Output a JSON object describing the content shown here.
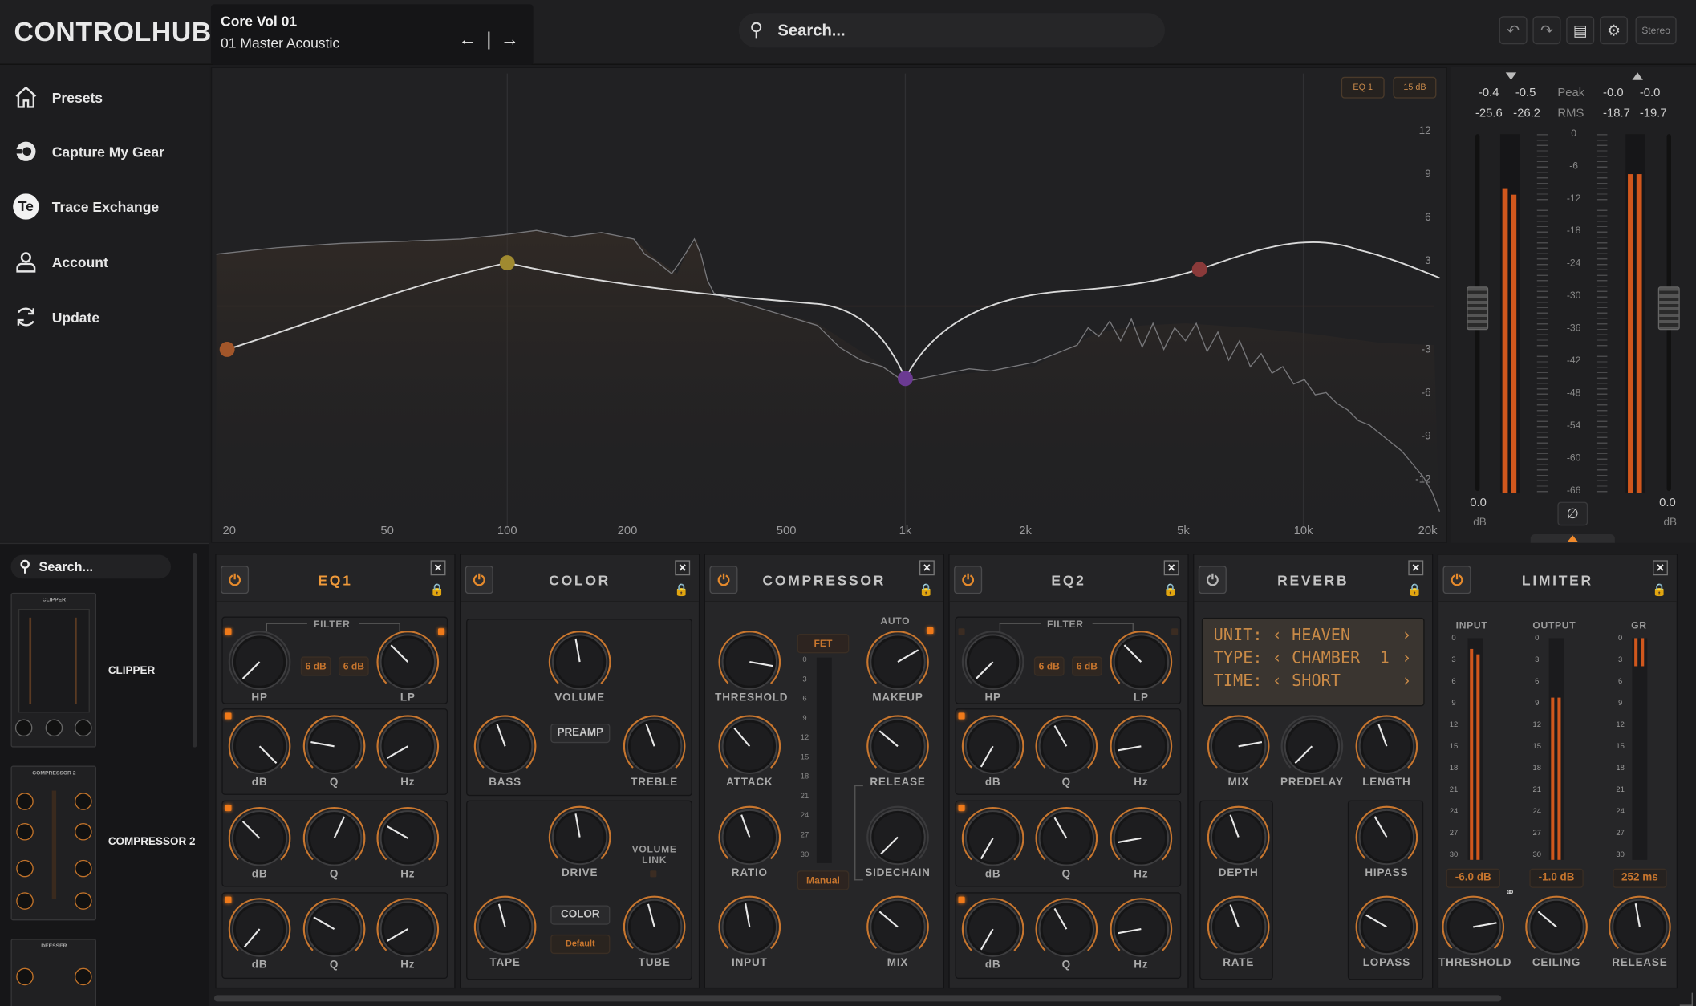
{
  "app": {
    "logo": "CONTROLHUB"
  },
  "preset": {
    "bank": "Core Vol 01",
    "name": "01 Master Acoustic",
    "nav": "← | →"
  },
  "search": {
    "placeholder": "Search..."
  },
  "toolbar": {
    "stereo": "Stereo",
    "icons": [
      "undo-icon",
      "redo-icon",
      "save-icon",
      "gear-icon"
    ]
  },
  "nav": {
    "items": [
      {
        "label": "Presets",
        "icon": "home-icon"
      },
      {
        "label": "Capture My Gear",
        "icon": "capture-icon"
      },
      {
        "label": "Trace Exchange",
        "icon": "te-icon",
        "glyph": "Te"
      },
      {
        "label": "Account",
        "icon": "user-icon"
      },
      {
        "label": "Update",
        "icon": "refresh-icon"
      }
    ]
  },
  "browser": {
    "search": "Search...",
    "items": [
      {
        "label": "CLIPPER",
        "thumb_title": "CLIPPER"
      },
      {
        "label": "COMPRESSOR 2",
        "thumb_title": "COMPRESSOR 2"
      },
      {
        "label": "",
        "thumb_title": "DEESSER"
      }
    ]
  },
  "eq_display": {
    "tags": [
      "EQ 1",
      "15 dB"
    ],
    "db_labels": [
      "12",
      "9",
      "6",
      "3",
      "-3",
      "-6",
      "-9",
      "-12"
    ],
    "freq_labels": [
      "20",
      "50",
      "100",
      "200",
      "500",
      "1k",
      "2k",
      "5k",
      "10k",
      "20k"
    ]
  },
  "meter": {
    "peak_label": "Peak",
    "rms_label": "RMS",
    "in_peak": [
      "-0.4",
      "-0.5"
    ],
    "in_rms": [
      "-25.6",
      "-26.2"
    ],
    "out_peak": [
      "-0.0",
      "-0.0"
    ],
    "out_rms": [
      "-18.7",
      "-19.7"
    ],
    "scale": [
      "0",
      "-6",
      "-12",
      "-18",
      "-24",
      "-30",
      "-36",
      "-42",
      "-48",
      "-54",
      "-60",
      "-66"
    ],
    "in_gain": "0.0",
    "out_gain": "0.0",
    "unit": "dB",
    "phase_icon": "phase-invert-icon",
    "levels": {
      "in_l": 0.85,
      "in_r": 0.83,
      "out_l": 0.89,
      "out_r": 0.89
    }
  },
  "modules": [
    {
      "title": "EQ1",
      "on": true
    },
    {
      "title": "COLOR",
      "on": false
    },
    {
      "title": "COMPRESSOR",
      "on": false
    },
    {
      "title": "EQ2",
      "on": false
    },
    {
      "title": "REVERB",
      "on": false
    },
    {
      "title": "LIMITER",
      "on": false
    }
  ],
  "eq1": {
    "filter": "FILTER",
    "slope_hp": "6 dB",
    "slope_lp": "6 dB",
    "row1": [
      "HP",
      "LP"
    ],
    "bands": [
      "dB",
      "Q",
      "Hz"
    ]
  },
  "color": {
    "volume": "VOLUME",
    "preamp": "PREAMP",
    "bass": "BASS",
    "treble": "TREBLE",
    "drive": "DRIVE",
    "volume_link": "VOLUME LINK",
    "color_btn": "COLOR",
    "default": "Default",
    "tape": "TAPE",
    "tube": "TUBE"
  },
  "compressor": {
    "threshold": "THRESHOLD",
    "type": "FET",
    "auto": "AUTO",
    "makeup": "MAKEUP",
    "attack": "ATTACK",
    "release": "RELEASE",
    "ratio": "RATIO",
    "sidechain": "SIDECHAIN",
    "input": "INPUT",
    "mix": "MIX",
    "mode": "Manual",
    "gr_scale": [
      "0",
      "3",
      "6",
      "9",
      "12",
      "15",
      "18",
      "21",
      "24",
      "27",
      "30"
    ]
  },
  "eq2": {
    "filter": "FILTER",
    "slope_hp": "6 dB",
    "slope_lp": "6 dB",
    "row1": [
      "HP",
      "LP"
    ],
    "bands": [
      "dB",
      "Q",
      "Hz"
    ]
  },
  "reverb": {
    "lcd": [
      {
        "key": "UNIT:",
        "value": "HEAVEN"
      },
      {
        "key": "TYPE:",
        "value": "CHAMBER  1"
      },
      {
        "key": "TIME:",
        "value": "SHORT"
      }
    ],
    "mix": "MIX",
    "predelay": "PREDELAY",
    "length": "LENGTH",
    "depth": "DEPTH",
    "hipass": "HIPASS",
    "rate": "RATE",
    "lopass": "LOPASS"
  },
  "limiter": {
    "input": "INPUT",
    "output": "OUTPUT",
    "gr": "GR",
    "scale": [
      "0",
      "3",
      "6",
      "9",
      "12",
      "15",
      "18",
      "21",
      "24",
      "27",
      "30"
    ],
    "input_val": "-6.0 dB",
    "output_val": "-1.0 dB",
    "gr_val": "252 ms",
    "threshold": "THRESHOLD",
    "ceiling": "CEILING",
    "release": "RELEASE"
  },
  "colors": {
    "accent": "#f08a2c",
    "bg": "#1c1c1e",
    "panel": "#262628",
    "curve": "#d9d9d9"
  }
}
